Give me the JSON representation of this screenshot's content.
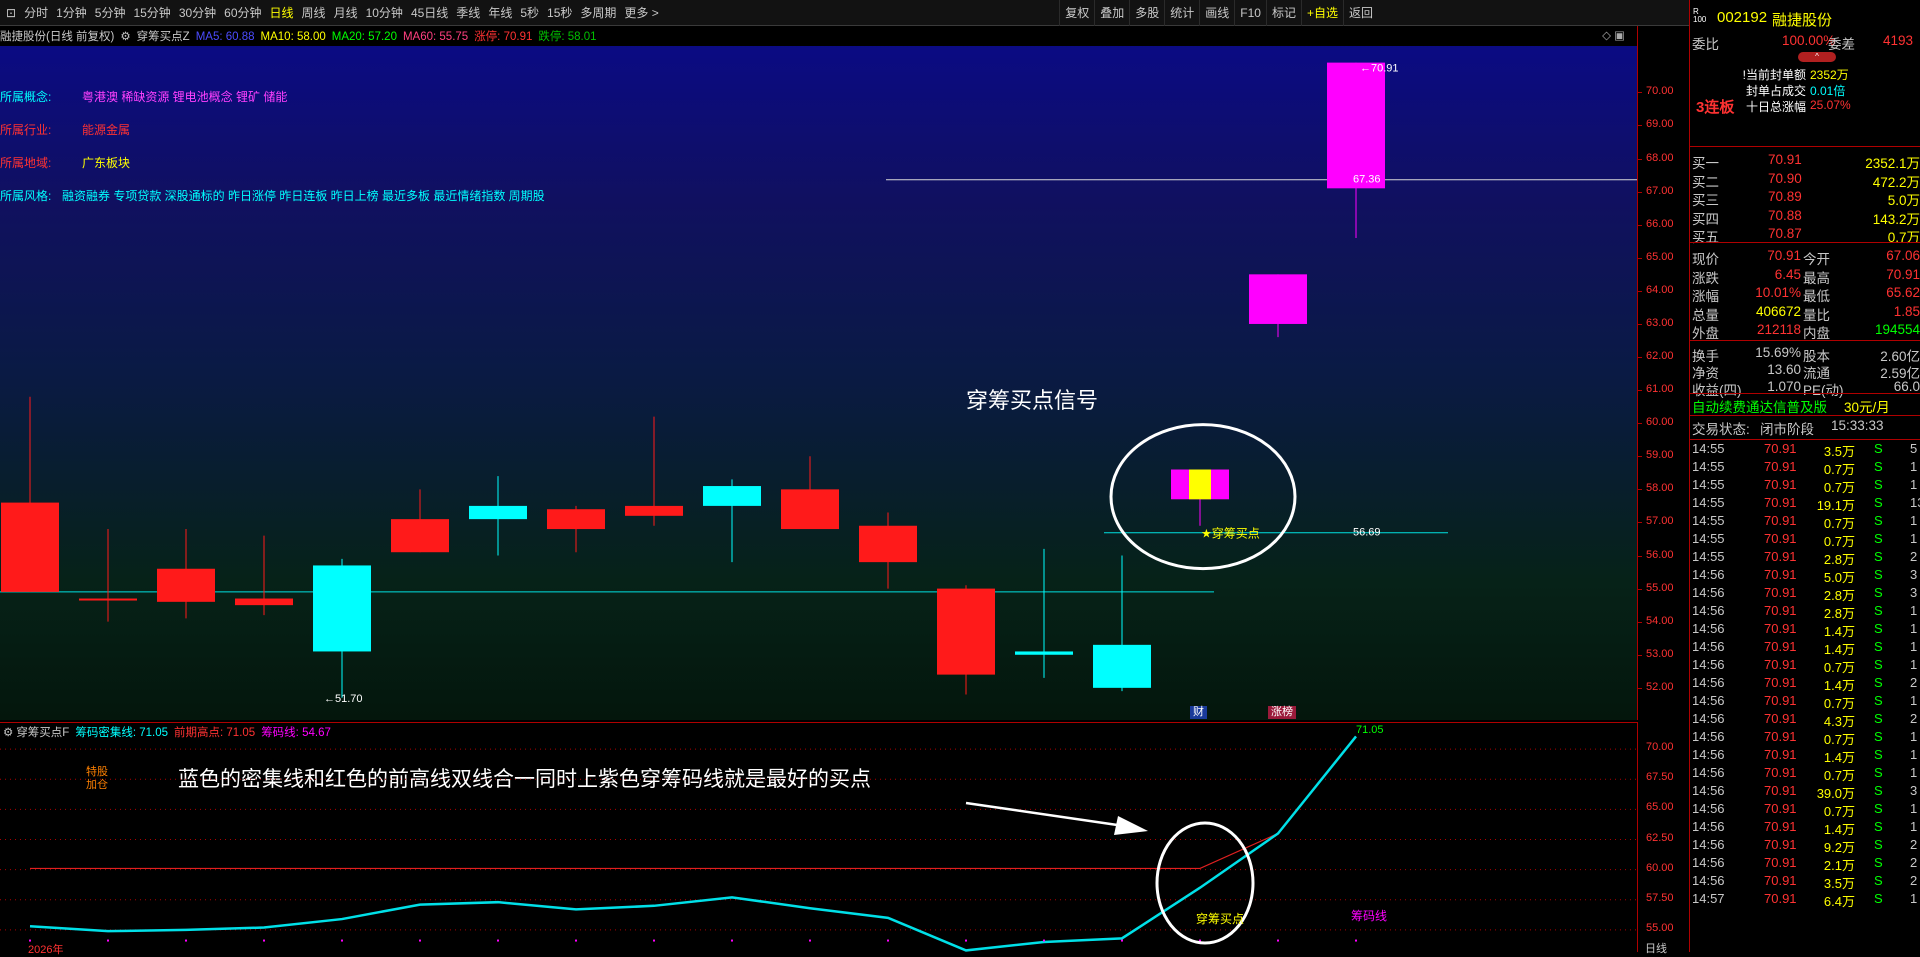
{
  "toolbar": {
    "left": [
      "分时",
      "1分钟",
      "5分钟",
      "15分钟",
      "30分钟",
      "60分钟",
      "日线",
      "周线",
      "月线",
      "10分钟",
      "45日线",
      "季线",
      "年线",
      "5秒",
      "15秒",
      "多周期",
      "更多 >"
    ],
    "active": "日线",
    "right": [
      "复权",
      "叠加",
      "多股",
      "统计",
      "画线",
      "F10",
      "标记",
      "+自选",
      "返回"
    ]
  },
  "main": {
    "stock_title": "融捷股份(日线 前复权)",
    "indicator_name": "穿筹买点Z",
    "ma": [
      {
        "label": "MA5: 60.88",
        "color": "#4c4cff"
      },
      {
        "label": "MA10: 58.00",
        "color": "#ffff00"
      },
      {
        "label": "MA20: 57.20",
        "color": "#00ff00"
      },
      {
        "label": "MA60: 55.75",
        "color": "#ff4080"
      },
      {
        "label": "涨停: 70.91",
        "color": "#ff3232"
      },
      {
        "label": "跌停: 58.01",
        "color": "#00c000"
      }
    ],
    "info": [
      {
        "label": "所属概念:",
        "value": "粤港澳 稀缺资源 锂电池概念 锂矿 储能",
        "label_color": "#00ffff",
        "value_color": "#ff40ff"
      },
      {
        "label": "所属行业:",
        "value": "能源金属",
        "label_color": "#ff3232",
        "value_color": "#ff3232"
      },
      {
        "label": "所属地域:",
        "value": "广东板块",
        "label_color": "#ff3232",
        "value_color": "#ffff00"
      },
      {
        "label": "所属风格:",
        "value": "融资融券 专项贷款 深股通标的 昨日涨停 昨日连板 昨日上榜 最近多板 最近情绪指数 周期股",
        "label_color": "#00ffff",
        "value_color": "#00ffff"
      }
    ],
    "annotation_signal": "穿筹买点信号",
    "buy_point_label": "穿筹买点",
    "price_level_5669": "56.69",
    "high_label": "70.91",
    "low_label": "51.70",
    "price_6736": "67.36",
    "bottom_tags": [
      "财",
      "涨榜"
    ]
  },
  "axis_main": {
    "ticks": [
      "70.00",
      "69.00",
      "68.00",
      "67.00",
      "66.00",
      "65.00",
      "64.00",
      "63.00",
      "62.00",
      "61.00",
      "60.00",
      "59.00",
      "58.00",
      "57.00",
      "56.00",
      "55.00",
      "54.00",
      "53.00",
      "52.00"
    ]
  },
  "axis_sub": {
    "ticks": [
      "70.00",
      "67.50",
      "65.00",
      "62.50",
      "60.00",
      "57.50",
      "55.00"
    ]
  },
  "sub": {
    "indicator_name": "穿筹买点F",
    "legend": [
      {
        "label": "筹码密集线: 71.05",
        "color": "#00ffff"
      },
      {
        "label": "前期高点: 71.05",
        "color": "#ff3232"
      },
      {
        "label": "筹码线: 54.67",
        "color": "#ff00ff"
      }
    ],
    "side_tags": [
      "特股",
      "加仓"
    ],
    "annotation": "蓝色的密集线和红色的前高线双线合一同时上紫色穿筹码线就是最好的买点",
    "buy_point_label": "穿筹买点",
    "chip_line_label": "筹码线",
    "year_label": "2026年",
    "top_value": "71.05",
    "period_label": "日线"
  },
  "chart_data": [
    {
      "type": "candlestick",
      "title": "融捷股份(日线 前复权)",
      "xlabel": "",
      "ylabel": "",
      "ylim": [
        51.3,
        71.1
      ],
      "candles": [
        {
          "o": 54.9,
          "h": 60.8,
          "l": 54.9,
          "c": 57.6
        },
        {
          "o": 54.7,
          "h": 56.8,
          "l": 54.0,
          "c": 54.7
        },
        {
          "o": 54.6,
          "h": 56.8,
          "l": 54.1,
          "c": 55.6
        },
        {
          "o": 54.5,
          "h": 56.6,
          "l": 54.2,
          "c": 54.7
        },
        {
          "o": 55.7,
          "h": 55.9,
          "l": 51.7,
          "c": 53.1
        },
        {
          "o": 56.1,
          "h": 58.0,
          "l": 56.1,
          "c": 57.1
        },
        {
          "o": 57.5,
          "h": 58.4,
          "l": 56.0,
          "c": 57.1
        },
        {
          "o": 56.8,
          "h": 57.5,
          "l": 56.1,
          "c": 57.4
        },
        {
          "o": 57.2,
          "h": 60.2,
          "l": 56.9,
          "c": 57.5
        },
        {
          "o": 58.1,
          "h": 58.3,
          "l": 55.8,
          "c": 57.5
        },
        {
          "o": 56.8,
          "h": 59.0,
          "l": 56.8,
          "c": 58.0
        },
        {
          "o": 55.8,
          "h": 57.3,
          "l": 55.0,
          "c": 56.9
        },
        {
          "o": 52.4,
          "h": 55.1,
          "l": 51.8,
          "c": 55.0
        },
        {
          "o": 53.1,
          "h": 56.2,
          "l": 52.3,
          "c": 53.0
        },
        {
          "o": 53.3,
          "h": 56.0,
          "l": 51.9,
          "c": 52.0
        },
        {
          "o": 57.7,
          "h": 58.6,
          "l": 56.9,
          "c": 58.6
        },
        {
          "o": 63.0,
          "h": 64.5,
          "l": 62.6,
          "c": 64.5
        },
        {
          "o": 67.1,
          "h": 70.9,
          "l": 65.6,
          "c": 70.9
        }
      ],
      "levels": [
        54.9,
        56.69,
        67.36
      ]
    },
    {
      "type": "line",
      "title": "穿筹买点F",
      "xlabel": "",
      "ylabel": "",
      "ylim": [
        53.5,
        71.5
      ],
      "series": [
        {
          "name": "筹码密集线",
          "color": "#00ffff",
          "values": [
            55.3,
            54.9,
            55.0,
            55.2,
            55.9,
            57.1,
            57.3,
            56.7,
            57.0,
            57.7,
            56.8,
            56.0,
            53.3,
            54.0,
            54.3,
            58.5,
            63.0,
            71.05
          ]
        },
        {
          "name": "前期高点",
          "color": "#ff3232",
          "values": [
            60.1,
            60.1,
            60.1,
            60.1,
            60.1,
            60.1,
            60.1,
            60.1,
            60.1,
            60.1,
            60.1,
            60.1,
            60.1,
            60.1,
            60.1,
            60.1,
            63.0,
            71.05
          ]
        }
      ]
    }
  ],
  "right": {
    "code": "002192",
    "name": "融捷股份",
    "weibi_label": "委比",
    "weibi_value": "100.00%",
    "weicha_label": "委差",
    "weicha_value": "4193",
    "seal_items": [
      {
        "label": "!当前封单额",
        "value": "2352万",
        "vcolor": "#ffff00"
      },
      {
        "label": "封单占成交",
        "value": "0.01倍",
        "vcolor": "#00ffff"
      },
      {
        "label": "十日总涨幅",
        "value": "25.07%",
        "vcolor": "#ff3232"
      }
    ],
    "streak": "3连板",
    "bids": [
      {
        "label": "买一",
        "price": "70.91",
        "vol": "2352.1万"
      },
      {
        "label": "买二",
        "price": "70.90",
        "vol": "472.2万"
      },
      {
        "label": "买三",
        "price": "70.89",
        "vol": "5.0万"
      },
      {
        "label": "买四",
        "price": "70.88",
        "vol": "143.2万"
      },
      {
        "label": "买五",
        "price": "70.87",
        "vol": "0.7万"
      }
    ],
    "quotes": [
      {
        "l1": "现价",
        "v1": "70.91",
        "c1": "#ff3232",
        "l2": "今开",
        "v2": "67.06",
        "c2": "#ff3232"
      },
      {
        "l1": "涨跌",
        "v1": "6.45",
        "c1": "#ff3232",
        "l2": "最高",
        "v2": "70.91",
        "c2": "#ff3232"
      },
      {
        "l1": "涨幅",
        "v1": "10.01%",
        "c1": "#ff3232",
        "l2": "最低",
        "v2": "65.62",
        "c2": "#ff3232"
      },
      {
        "l1": "总量",
        "v1": "406672",
        "c1": "#ffff00",
        "l2": "量比",
        "v2": "1.85",
        "c2": "#ff3232"
      },
      {
        "l1": "外盘",
        "v1": "212118",
        "c1": "#ff3232",
        "l2": "内盘",
        "v2": "194554",
        "c2": "#00ff00"
      }
    ],
    "fundamentals": [
      {
        "l1": "换手",
        "v1": "15.69%",
        "l2": "股本",
        "v2": "2.60亿"
      },
      {
        "l1": "净资",
        "v1": "13.60",
        "l2": "流通",
        "v2": "2.59亿"
      },
      {
        "l1": "收益(四)",
        "v1": "1.070",
        "l2": "PE(动)",
        "v2": "66.0"
      }
    ],
    "promo": "自动续费通达信普及版",
    "promo_price": "30元/月",
    "status_label": "交易状态:",
    "status_value": "闭市阶段",
    "status_time": "15:33:33",
    "ticks": [
      {
        "t": "14:55",
        "p": "70.91",
        "v": "3.5万",
        "s": "S",
        "n": "5"
      },
      {
        "t": "14:55",
        "p": "70.91",
        "v": "0.7万",
        "s": "S",
        "n": "1"
      },
      {
        "t": "14:55",
        "p": "70.91",
        "v": "0.7万",
        "s": "S",
        "n": "1"
      },
      {
        "t": "14:55",
        "p": "70.91",
        "v": "19.1万",
        "s": "S",
        "n": "13"
      },
      {
        "t": "14:55",
        "p": "70.91",
        "v": "0.7万",
        "s": "S",
        "n": "1"
      },
      {
        "t": "14:55",
        "p": "70.91",
        "v": "0.7万",
        "s": "S",
        "n": "1"
      },
      {
        "t": "14:55",
        "p": "70.91",
        "v": "2.8万",
        "s": "S",
        "n": "2"
      },
      {
        "t": "14:56",
        "p": "70.91",
        "v": "5.0万",
        "s": "S",
        "n": "3"
      },
      {
        "t": "14:56",
        "p": "70.91",
        "v": "2.8万",
        "s": "S",
        "n": "3"
      },
      {
        "t": "14:56",
        "p": "70.91",
        "v": "2.8万",
        "s": "S",
        "n": "1"
      },
      {
        "t": "14:56",
        "p": "70.91",
        "v": "1.4万",
        "s": "S",
        "n": "1"
      },
      {
        "t": "14:56",
        "p": "70.91",
        "v": "1.4万",
        "s": "S",
        "n": "1"
      },
      {
        "t": "14:56",
        "p": "70.91",
        "v": "0.7万",
        "s": "S",
        "n": "1"
      },
      {
        "t": "14:56",
        "p": "70.91",
        "v": "1.4万",
        "s": "S",
        "n": "2"
      },
      {
        "t": "14:56",
        "p": "70.91",
        "v": "0.7万",
        "s": "S",
        "n": "1"
      },
      {
        "t": "14:56",
        "p": "70.91",
        "v": "4.3万",
        "s": "S",
        "n": "2"
      },
      {
        "t": "14:56",
        "p": "70.91",
        "v": "0.7万",
        "s": "S",
        "n": "1"
      },
      {
        "t": "14:56",
        "p": "70.91",
        "v": "1.4万",
        "s": "S",
        "n": "1"
      },
      {
        "t": "14:56",
        "p": "70.91",
        "v": "0.7万",
        "s": "S",
        "n": "1"
      },
      {
        "t": "14:56",
        "p": "70.91",
        "v": "39.0万",
        "s": "S",
        "n": "3"
      },
      {
        "t": "14:56",
        "p": "70.91",
        "v": "0.7万",
        "s": "S",
        "n": "1"
      },
      {
        "t": "14:56",
        "p": "70.91",
        "v": "1.4万",
        "s": "S",
        "n": "1"
      },
      {
        "t": "14:56",
        "p": "70.91",
        "v": "9.2万",
        "s": "S",
        "n": "2"
      },
      {
        "t": "14:56",
        "p": "70.91",
        "v": "2.1万",
        "s": "S",
        "n": "2"
      },
      {
        "t": "14:56",
        "p": "70.91",
        "v": "3.5万",
        "s": "S",
        "n": "2"
      },
      {
        "t": "14:57",
        "p": "70.91",
        "v": "6.4万",
        "s": "S",
        "n": "1"
      }
    ]
  }
}
